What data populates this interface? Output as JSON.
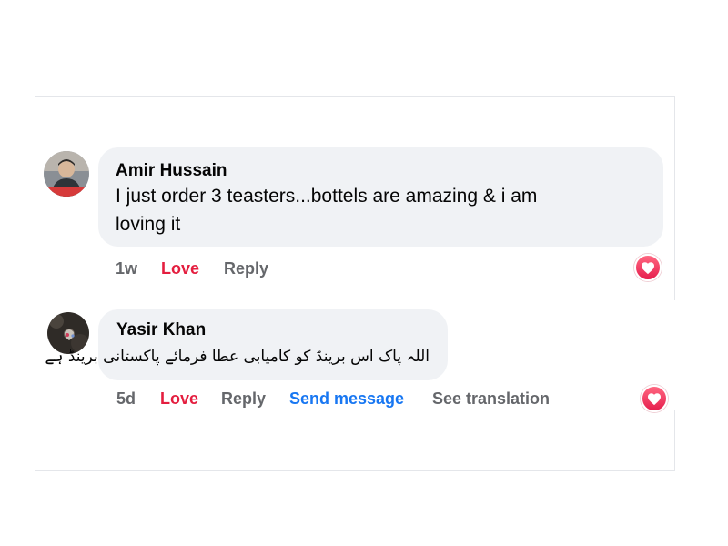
{
  "comments": [
    {
      "author": "Amir Hussain",
      "text_line1": "I just order 3 teasters...bottels are amazing & i am",
      "text_line2": "loving it",
      "time": "1w",
      "love_label": "Love",
      "reply_label": "Reply",
      "reaction_icon": "heart-icon"
    },
    {
      "author": "Yasir Khan",
      "text": "اللہ پاک اس برینڈ کو کامیابی عطا فرمائے پاکستانی برینڈ ہے",
      "time": "5d",
      "love_label": "Love",
      "reply_label": "Reply",
      "send_message_label": "Send message",
      "see_translation_label": "See translation",
      "reaction_icon": "heart-icon"
    }
  ],
  "colors": {
    "love": "#e41e3f",
    "link": "#1877f2",
    "bubble": "#f0f2f5",
    "muted": "#65676b"
  }
}
